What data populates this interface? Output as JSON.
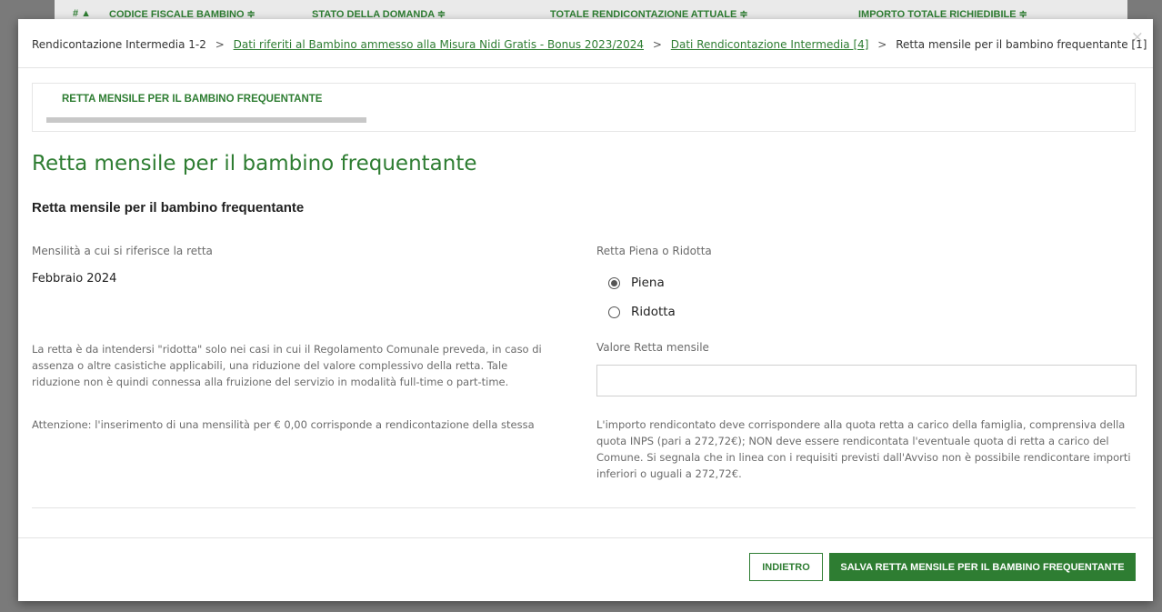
{
  "background_table": {
    "columns": [
      "# ▲",
      "CODICE FISCALE BAMBINO ≑",
      "STATO DELLA DOMANDA ≑",
      "TOTALE RENDICONTAZIONE ATTUALE ≑",
      "IMPORTO TOTALE RICHIEDIBILE ≑"
    ]
  },
  "breadcrumb": {
    "item1": "Rendicontazione Intermedia 1-2",
    "item2": "Dati riferiti al Bambino ammesso alla Misura Nidi Gratis - Bonus 2023/2024",
    "item3": "Dati Rendicontazione Intermedia [4]",
    "item4": "Retta mensile per il bambino frequentante [1]",
    "separator": ">"
  },
  "close_icon": "×",
  "stepper": {
    "label": "RETTA MENSILE PER IL BAMBINO FREQUENTANTE"
  },
  "page_title": "Retta mensile per il bambino frequentante",
  "section_title": "Retta mensile per il bambino frequentante",
  "form": {
    "month_label": "Mensilità a cui si riferisce la retta",
    "month_value": "Febbraio 2024",
    "type_label": "Retta Piena o Ridotta",
    "type_options": [
      "Piena",
      "Ridotta"
    ],
    "type_selected": "Piena",
    "amount_label": "Valore Retta mensile",
    "amount_value": ""
  },
  "notes": {
    "left_1": "La retta è da intendersi \"ridotta\" solo nei casi in cui il Regolamento Comunale preveda, in caso di assenza o altre casistiche applicabili, una riduzione del valore complessivo della retta. Tale riduzione non è quindi connessa alla fruizione del servizio in modalità full-time o part-time.",
    "left_2": "Attenzione: l'inserimento di una mensilità per € 0,00 corrisponde a rendicontazione della stessa",
    "right": "L'importo rendicontato deve corrispondere alla quota retta a carico della famiglia, comprensiva della quota INPS (pari a 272,72€); NON deve essere rendicontata l'eventuale quota di retta a carico del Comune. Si segnala che in linea con i requisiti previsti dall'Avviso non è possibile rendicontare importi inferiori o uguali a 272,72€."
  },
  "buttons": {
    "back": "INDIETRO",
    "save": "SALVA RETTA MENSILE PER IL BAMBINO FREQUENTANTE"
  },
  "colors": {
    "accent": "#2e7d32",
    "overlay": "#7a7a7a"
  }
}
